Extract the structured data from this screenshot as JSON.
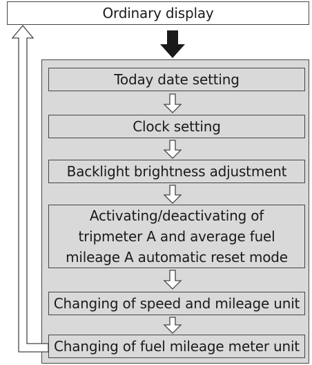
{
  "top": "Ordinary display",
  "steps": [
    {
      "lines": [
        "Today date setting"
      ]
    },
    {
      "lines": [
        "Clock setting"
      ]
    },
    {
      "lines": [
        "Backlight brightness adjustment"
      ]
    },
    {
      "lines": [
        "Activating/deactivating of",
        "tripmeter A and average fuel",
        "mileage A automatic reset mode"
      ]
    },
    {
      "lines": [
        "Changing of speed and mileage unit"
      ]
    },
    {
      "lines": [
        "Changing of fuel mileage meter unit"
      ]
    }
  ],
  "colors": {
    "panel_fill": "#d9d9d9",
    "outline": "#444444",
    "arrow_solid": "#1a1a1a"
  },
  "icons": {
    "down_solid": "arrow-down-solid-icon",
    "down_outline": "arrow-down-outline-icon",
    "return_loop": "return-arrow-icon"
  }
}
